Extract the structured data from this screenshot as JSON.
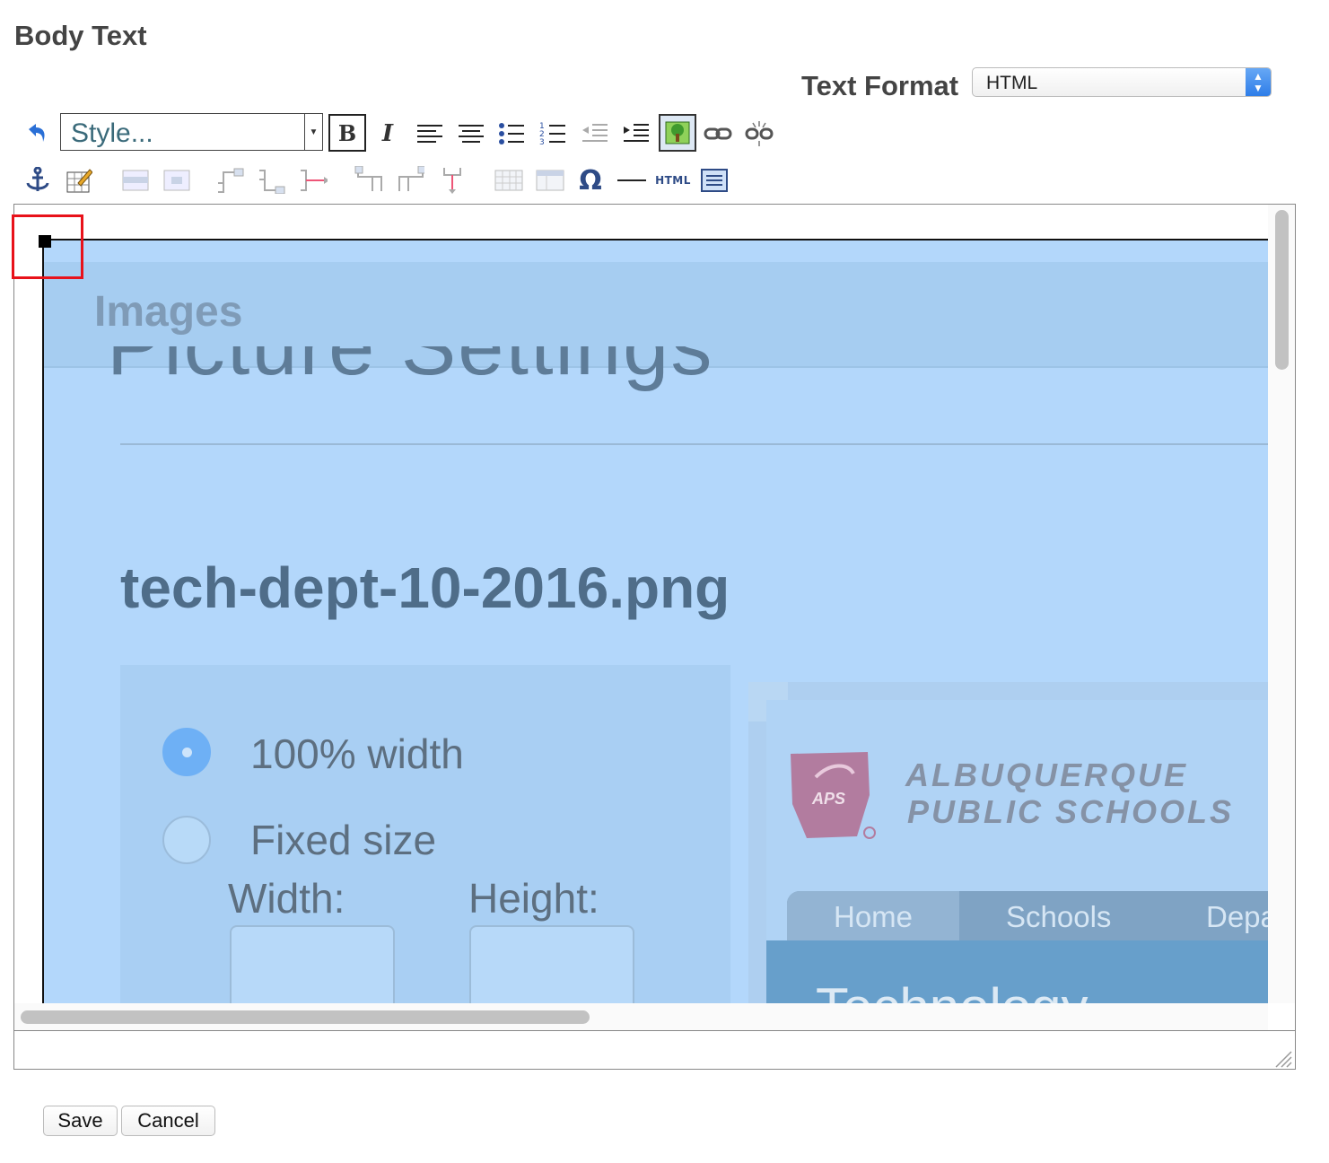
{
  "section": {
    "title": "Body Text"
  },
  "text_format": {
    "label": "Text Format",
    "selected": "HTML"
  },
  "toolbar": {
    "style_placeholder": "Style...",
    "html_source_label": "HTML",
    "icons_row1": [
      "undo-icon",
      "bold-icon",
      "italic-icon",
      "align-left-icon",
      "align-center-icon",
      "bullet-list-icon",
      "numbered-list-icon",
      "outdent-icon",
      "indent-icon",
      "image-icon",
      "link-icon",
      "unlink-icon"
    ],
    "icons_row2": [
      "anchor-icon",
      "edit-table-icon",
      "table-row-props-icon",
      "table-cell-props-icon",
      "insert-row-before-icon",
      "insert-row-after-icon",
      "delete-row-icon",
      "insert-col-before-icon",
      "insert-col-after-icon",
      "delete-col-icon",
      "split-cells-icon",
      "merge-cells-icon",
      "special-char-icon",
      "horizontal-rule-icon",
      "html-source-icon",
      "fullscreen-icon"
    ]
  },
  "embedded_image": {
    "header": "Images",
    "clipped_title": "Picture Settings",
    "file_name": "tech-dept-10-2016.png",
    "options": {
      "full_width": "100% width",
      "fixed_size": "Fixed size",
      "full_width_selected": true
    },
    "width_label": "Width:",
    "height_label": "Height:",
    "logo_line1": "ALBUQUERQUE",
    "logo_line2": "PUBLIC SCHOOLS",
    "logo_badge": "APS",
    "nav_items": [
      "Home",
      "Schools",
      "Depa"
    ],
    "strip_text": "Technology"
  },
  "buttons": {
    "save": "Save",
    "cancel": "Cancel"
  },
  "colors": {
    "selection_overlay": "#b3d7fb",
    "highlight_box": "#e8121a"
  }
}
